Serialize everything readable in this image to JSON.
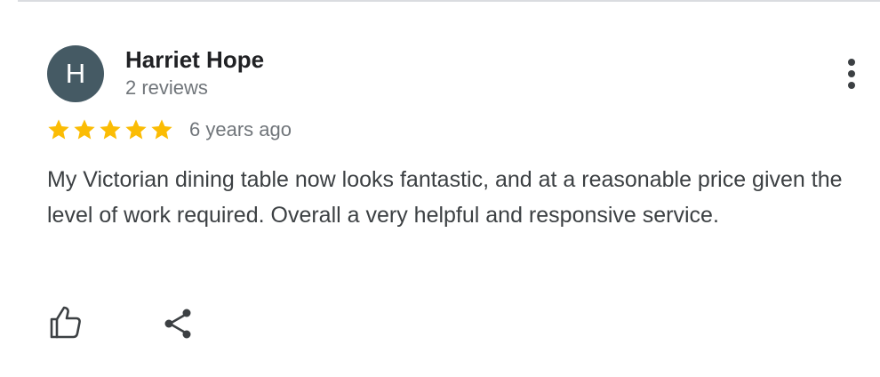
{
  "review": {
    "avatar_letter": "H",
    "reviewer_name": "Harriet Hope",
    "review_count": "2 reviews",
    "rating": 5,
    "rating_max": 5,
    "date": "6 years ago",
    "text": "My Victorian dining table now looks fantastic, and at a reasonable price given the level of work required. Overall a very helpful and responsive service."
  },
  "icons": {
    "more": "more-vertical-icon",
    "star": "star-icon",
    "like": "thumbs-up-icon",
    "share": "share-icon"
  },
  "colors": {
    "avatar_bg": "#455a64",
    "star": "#fbbc04",
    "name_text": "#202124",
    "secondary_text": "#70757a",
    "body_text": "#3c4043",
    "divider": "#dadce0"
  }
}
